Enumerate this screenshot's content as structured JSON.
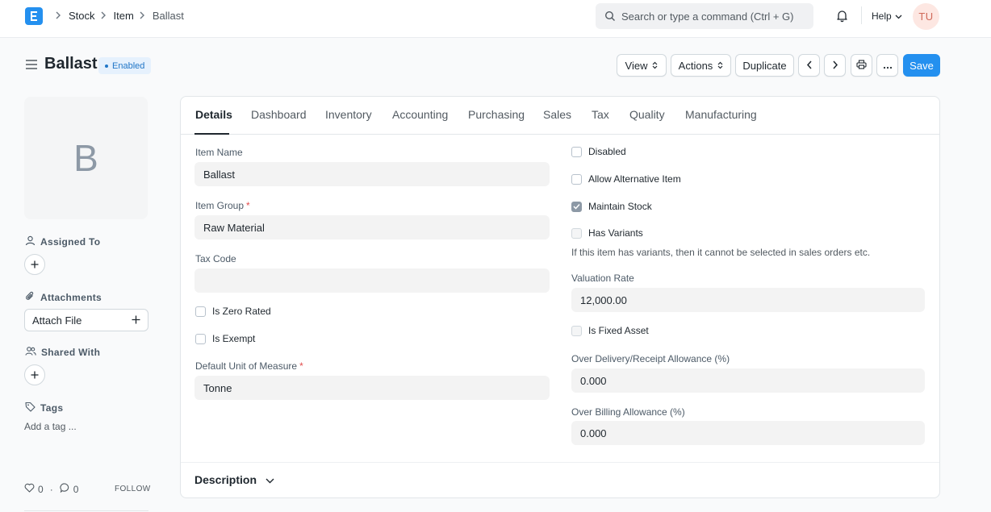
{
  "navbar": {
    "logo_letter": "E",
    "breadcrumbs": [
      "Stock",
      "Item",
      "Ballast"
    ],
    "search_placeholder": "Search or type a command (Ctrl + G)",
    "help_label": "Help",
    "user_initials": "TU"
  },
  "page": {
    "title": "Ballast",
    "status": "Enabled",
    "accent_color": "#2490ef"
  },
  "toolbar": {
    "view_label": "View",
    "actions_label": "Actions",
    "duplicate_label": "Duplicate",
    "save_label": "Save"
  },
  "sidebar": {
    "image_letter": "B",
    "assigned_to_label": "Assigned To",
    "attachments_label": "Attachments",
    "attach_file_label": "Attach File",
    "shared_with_label": "Shared With",
    "tags_label": "Tags",
    "add_tag_label": "Add a tag ...",
    "likes_count": "0",
    "comments_count": "0",
    "follow_label": "FOLLOW"
  },
  "tabs": [
    "Details",
    "Dashboard",
    "Inventory",
    "Accounting",
    "Purchasing",
    "Sales",
    "Tax",
    "Quality",
    "Manufacturing"
  ],
  "form": {
    "item_name_label": "Item Name",
    "item_name_value": "Ballast",
    "item_group_label": "Item Group",
    "item_group_value": "Raw Material",
    "tax_code_label": "Tax Code",
    "tax_code_value": "",
    "is_zero_rated_label": "Is Zero Rated",
    "is_exempt_label": "Is Exempt",
    "uom_label": "Default Unit of Measure",
    "uom_value": "Tonne",
    "disabled_label": "Disabled",
    "allow_alt_label": "Allow Alternative Item",
    "maintain_stock_label": "Maintain Stock",
    "has_variants_label": "Has Variants",
    "has_variants_note": "If this item has variants, then it cannot be selected in sales orders etc.",
    "valuation_rate_label": "Valuation Rate",
    "valuation_rate_value": "12,000.00",
    "is_fixed_asset_label": "Is Fixed Asset",
    "over_delivery_label": "Over Delivery/Receipt Allowance (%)",
    "over_delivery_value": "0.000",
    "over_billing_label": "Over Billing Allowance (%)",
    "over_billing_value": "0.000"
  },
  "description_section": {
    "label": "Description"
  }
}
